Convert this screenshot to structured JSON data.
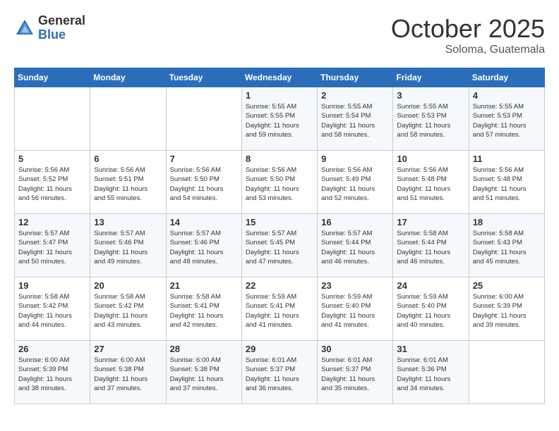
{
  "header": {
    "logo_general": "General",
    "logo_blue": "Blue",
    "month": "October 2025",
    "location": "Soloma, Guatemala"
  },
  "weekdays": [
    "Sunday",
    "Monday",
    "Tuesday",
    "Wednesday",
    "Thursday",
    "Friday",
    "Saturday"
  ],
  "weeks": [
    [
      {
        "day": "",
        "info": ""
      },
      {
        "day": "",
        "info": ""
      },
      {
        "day": "",
        "info": ""
      },
      {
        "day": "1",
        "info": "Sunrise: 5:55 AM\nSunset: 5:55 PM\nDaylight: 11 hours\nand 59 minutes."
      },
      {
        "day": "2",
        "info": "Sunrise: 5:55 AM\nSunset: 5:54 PM\nDaylight: 11 hours\nand 58 minutes."
      },
      {
        "day": "3",
        "info": "Sunrise: 5:55 AM\nSunset: 5:53 PM\nDaylight: 11 hours\nand 58 minutes."
      },
      {
        "day": "4",
        "info": "Sunrise: 5:55 AM\nSunset: 5:53 PM\nDaylight: 11 hours\nand 57 minutes."
      }
    ],
    [
      {
        "day": "5",
        "info": "Sunrise: 5:56 AM\nSunset: 5:52 PM\nDaylight: 11 hours\nand 56 minutes."
      },
      {
        "day": "6",
        "info": "Sunrise: 5:56 AM\nSunset: 5:51 PM\nDaylight: 11 hours\nand 55 minutes."
      },
      {
        "day": "7",
        "info": "Sunrise: 5:56 AM\nSunset: 5:50 PM\nDaylight: 11 hours\nand 54 minutes."
      },
      {
        "day": "8",
        "info": "Sunrise: 5:56 AM\nSunset: 5:50 PM\nDaylight: 11 hours\nand 53 minutes."
      },
      {
        "day": "9",
        "info": "Sunrise: 5:56 AM\nSunset: 5:49 PM\nDaylight: 11 hours\nand 52 minutes."
      },
      {
        "day": "10",
        "info": "Sunrise: 5:56 AM\nSunset: 5:48 PM\nDaylight: 11 hours\nand 51 minutes."
      },
      {
        "day": "11",
        "info": "Sunrise: 5:56 AM\nSunset: 5:48 PM\nDaylight: 11 hours\nand 51 minutes."
      }
    ],
    [
      {
        "day": "12",
        "info": "Sunrise: 5:57 AM\nSunset: 5:47 PM\nDaylight: 11 hours\nand 50 minutes."
      },
      {
        "day": "13",
        "info": "Sunrise: 5:57 AM\nSunset: 5:46 PM\nDaylight: 11 hours\nand 49 minutes."
      },
      {
        "day": "14",
        "info": "Sunrise: 5:57 AM\nSunset: 5:46 PM\nDaylight: 11 hours\nand 48 minutes."
      },
      {
        "day": "15",
        "info": "Sunrise: 5:57 AM\nSunset: 5:45 PM\nDaylight: 11 hours\nand 47 minutes."
      },
      {
        "day": "16",
        "info": "Sunrise: 5:57 AM\nSunset: 5:44 PM\nDaylight: 11 hours\nand 46 minutes."
      },
      {
        "day": "17",
        "info": "Sunrise: 5:58 AM\nSunset: 5:44 PM\nDaylight: 11 hours\nand 46 minutes."
      },
      {
        "day": "18",
        "info": "Sunrise: 5:58 AM\nSunset: 5:43 PM\nDaylight: 11 hours\nand 45 minutes."
      }
    ],
    [
      {
        "day": "19",
        "info": "Sunrise: 5:58 AM\nSunset: 5:42 PM\nDaylight: 11 hours\nand 44 minutes."
      },
      {
        "day": "20",
        "info": "Sunrise: 5:58 AM\nSunset: 5:42 PM\nDaylight: 11 hours\nand 43 minutes."
      },
      {
        "day": "21",
        "info": "Sunrise: 5:58 AM\nSunset: 5:41 PM\nDaylight: 11 hours\nand 42 minutes."
      },
      {
        "day": "22",
        "info": "Sunrise: 5:59 AM\nSunset: 5:41 PM\nDaylight: 11 hours\nand 41 minutes."
      },
      {
        "day": "23",
        "info": "Sunrise: 5:59 AM\nSunset: 5:40 PM\nDaylight: 11 hours\nand 41 minutes."
      },
      {
        "day": "24",
        "info": "Sunrise: 5:59 AM\nSunset: 5:40 PM\nDaylight: 11 hours\nand 40 minutes."
      },
      {
        "day": "25",
        "info": "Sunrise: 6:00 AM\nSunset: 5:39 PM\nDaylight: 11 hours\nand 39 minutes."
      }
    ],
    [
      {
        "day": "26",
        "info": "Sunrise: 6:00 AM\nSunset: 5:39 PM\nDaylight: 11 hours\nand 38 minutes."
      },
      {
        "day": "27",
        "info": "Sunrise: 6:00 AM\nSunset: 5:38 PM\nDaylight: 11 hours\nand 37 minutes."
      },
      {
        "day": "28",
        "info": "Sunrise: 6:00 AM\nSunset: 5:38 PM\nDaylight: 11 hours\nand 37 minutes."
      },
      {
        "day": "29",
        "info": "Sunrise: 6:01 AM\nSunset: 5:37 PM\nDaylight: 11 hours\nand 36 minutes."
      },
      {
        "day": "30",
        "info": "Sunrise: 6:01 AM\nSunset: 5:37 PM\nDaylight: 11 hours\nand 35 minutes."
      },
      {
        "day": "31",
        "info": "Sunrise: 6:01 AM\nSunset: 5:36 PM\nDaylight: 11 hours\nand 34 minutes."
      },
      {
        "day": "",
        "info": ""
      }
    ]
  ]
}
